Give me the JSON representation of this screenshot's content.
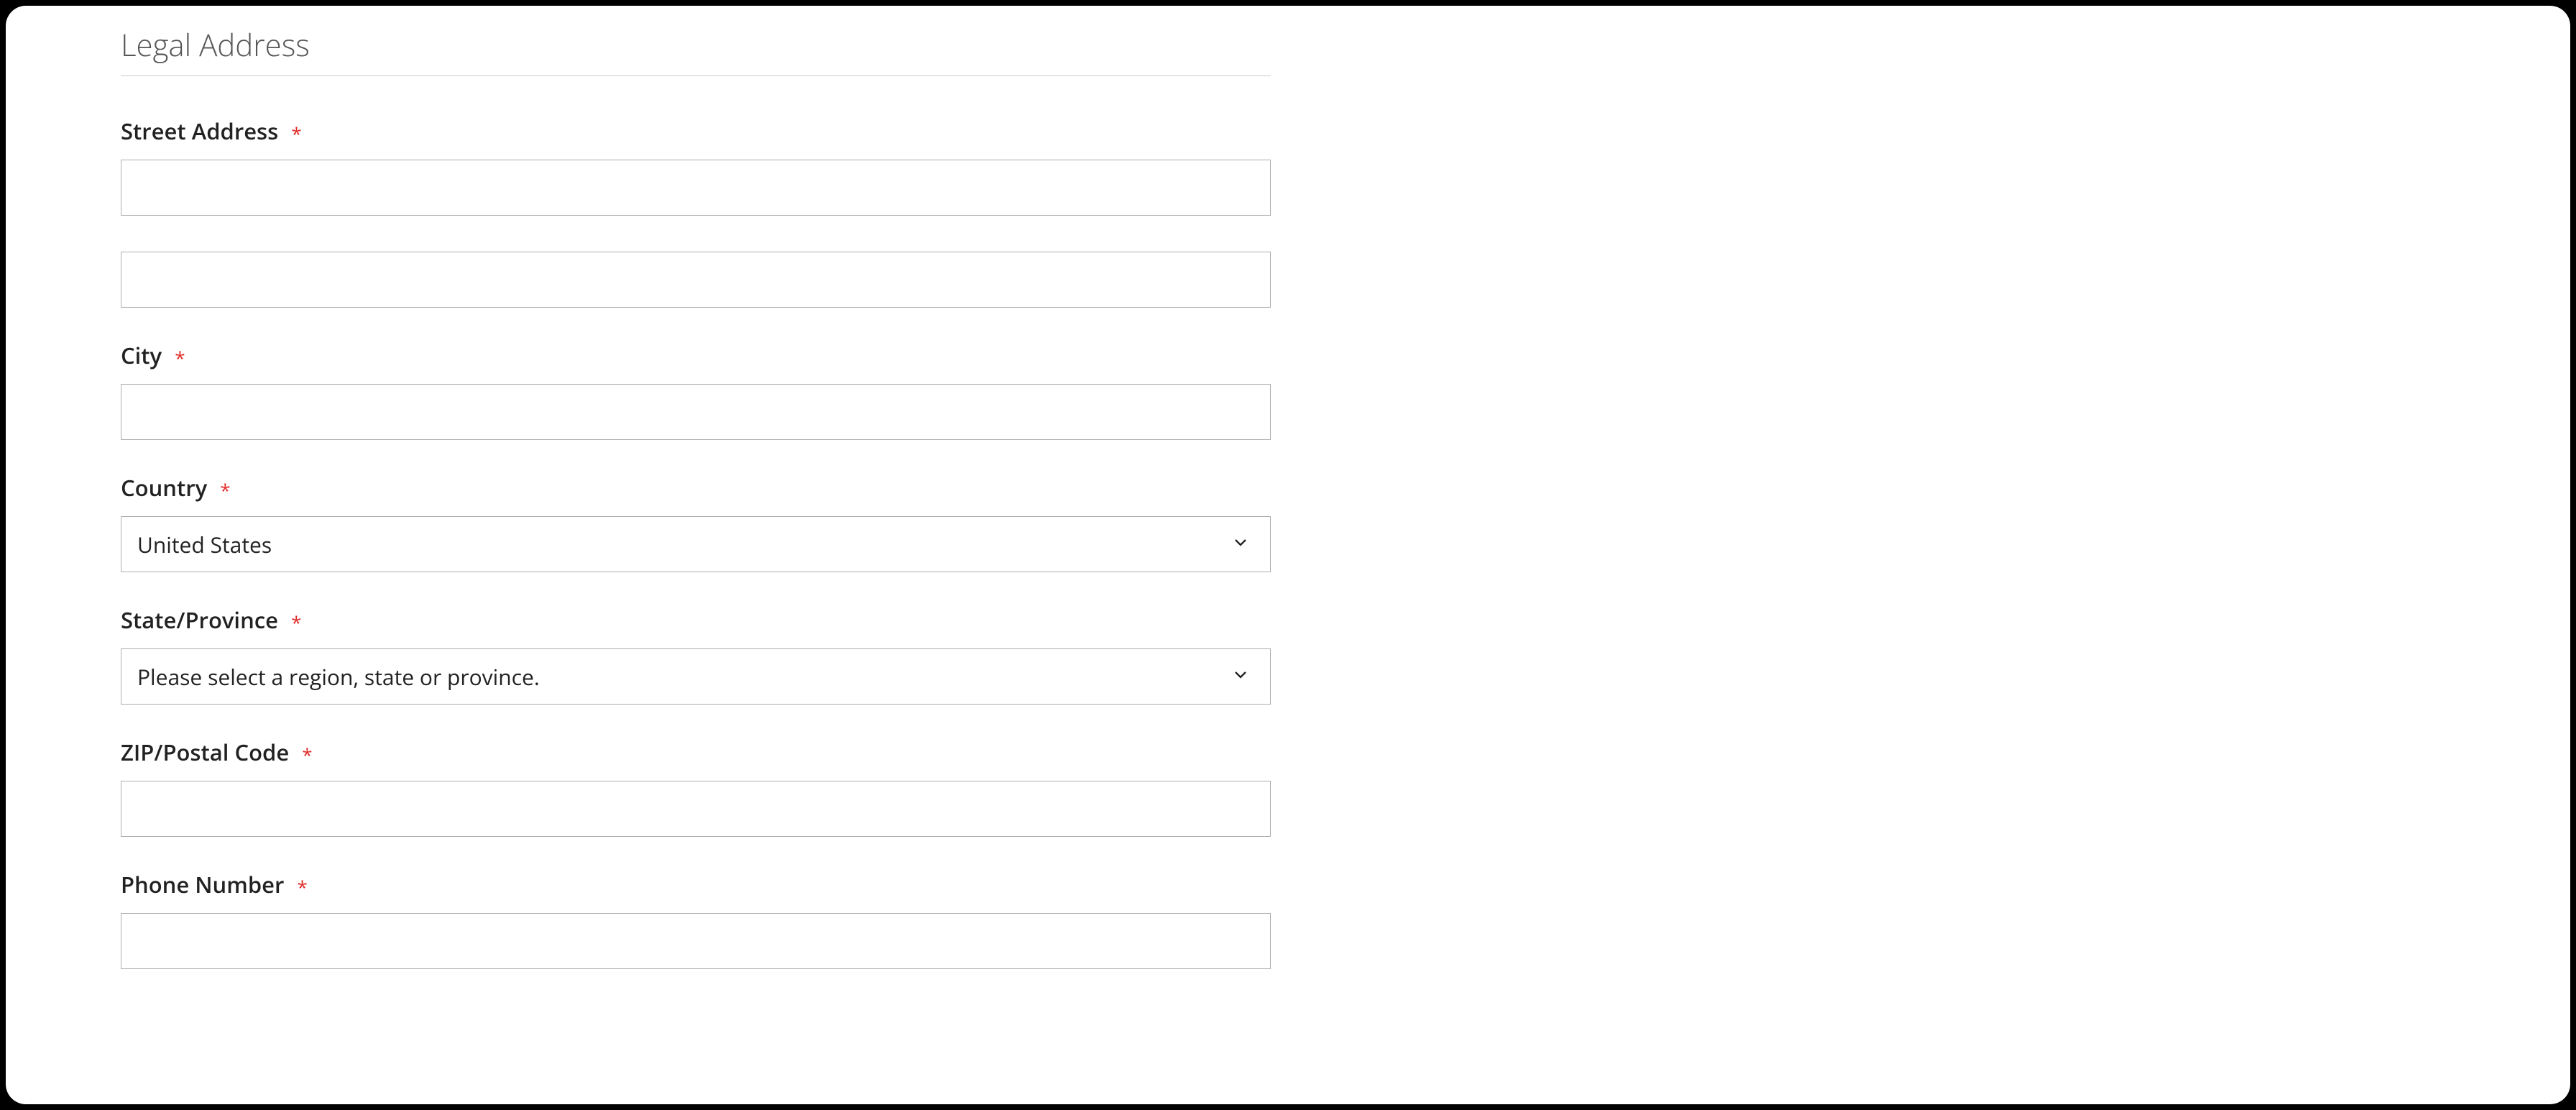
{
  "section": {
    "title": "Legal Address"
  },
  "fields": {
    "street": {
      "label": "Street Address",
      "value1": "",
      "value2": ""
    },
    "city": {
      "label": "City",
      "value": ""
    },
    "country": {
      "label": "Country",
      "selected": "United States"
    },
    "state": {
      "label": "State/Province",
      "selected": "Please select a region, state or province."
    },
    "zip": {
      "label": "ZIP/Postal Code",
      "value": ""
    },
    "phone": {
      "label": "Phone Number",
      "value": ""
    }
  },
  "required_marker": "*"
}
